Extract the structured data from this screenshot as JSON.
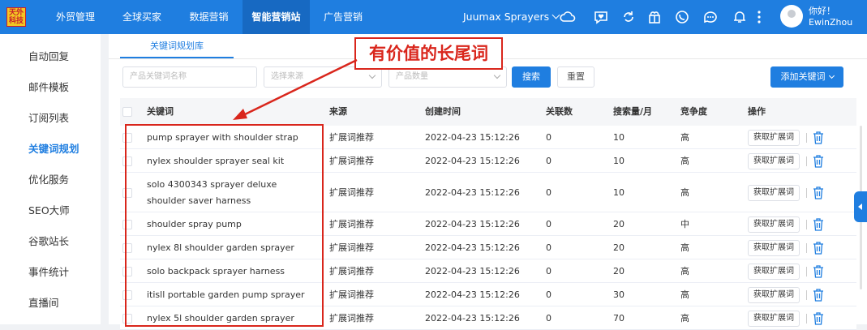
{
  "logo_text": "天外 科技",
  "topnav": {
    "items": [
      "外贸管理",
      "全球买家",
      "数据营销",
      "智能营销站",
      "广告营销"
    ],
    "active_index": 3,
    "brand": "Juumax Sprayers",
    "icons": [
      "cloud-icon",
      "chat-heart-icon",
      "sync-icon",
      "gift-icon",
      "whatsapp-icon",
      "message-icon",
      "bell-icon",
      "more-icon"
    ],
    "user_greeting": "你好！",
    "user_name": "EwinZhou"
  },
  "sidebar": {
    "items": [
      "自动回复",
      "邮件模板",
      "订阅列表",
      "关键词规划",
      "优化服务",
      "SEO大师",
      "谷歌站长",
      "事件统计",
      "直播间"
    ],
    "active_index": 3
  },
  "tab": {
    "label": "关键词规划库"
  },
  "filters": {
    "keyword_placeholder": "产品关键词名称",
    "source_placeholder": "选择来源",
    "count_placeholder": "产品数量",
    "search_label": "搜索",
    "reset_label": "重置",
    "add_label": "添加关键词"
  },
  "table": {
    "headers": [
      "关键词",
      "来源",
      "创建时间",
      "关联数",
      "搜索量/月",
      "竞争度",
      "操作"
    ],
    "action_label": "获取扩展词",
    "rows": [
      {
        "keyword": "pump sprayer with shoulder strap",
        "source": "扩展词推荐",
        "created": "2022-04-23 15:12:26",
        "linked": "0",
        "volume": "10",
        "competition": "高"
      },
      {
        "keyword": "nylex shoulder sprayer seal kit",
        "source": "扩展词推荐",
        "created": "2022-04-23 15:12:26",
        "linked": "0",
        "volume": "10",
        "competition": "高"
      },
      {
        "keyword": "solo 4300343 sprayer deluxe shoulder saver harness",
        "source": "扩展词推荐",
        "created": "2022-04-23 15:12:26",
        "linked": "0",
        "volume": "10",
        "competition": "高"
      },
      {
        "keyword": "shoulder spray pump",
        "source": "扩展词推荐",
        "created": "2022-04-23 15:12:26",
        "linked": "0",
        "volume": "20",
        "competition": "中"
      },
      {
        "keyword": "nylex 8l shoulder garden sprayer",
        "source": "扩展词推荐",
        "created": "2022-04-23 15:12:26",
        "linked": "0",
        "volume": "20",
        "competition": "高"
      },
      {
        "keyword": "solo backpack sprayer harness",
        "source": "扩展词推荐",
        "created": "2022-04-23 15:12:26",
        "linked": "0",
        "volume": "20",
        "competition": "高"
      },
      {
        "keyword": "itisll portable garden pump sprayer",
        "source": "扩展词推荐",
        "created": "2022-04-23 15:12:26",
        "linked": "0",
        "volume": "30",
        "competition": "高"
      },
      {
        "keyword": "nylex 5l shoulder garden sprayer",
        "source": "扩展词推荐",
        "created": "2022-04-23 15:12:26",
        "linked": "0",
        "volume": "70",
        "competition": "高"
      }
    ]
  },
  "annotation": {
    "callout_text": "有价值的长尾词",
    "color": "#d9261c"
  },
  "colors": {
    "primary": "#1f7ee0",
    "annotation": "#d9261c"
  }
}
